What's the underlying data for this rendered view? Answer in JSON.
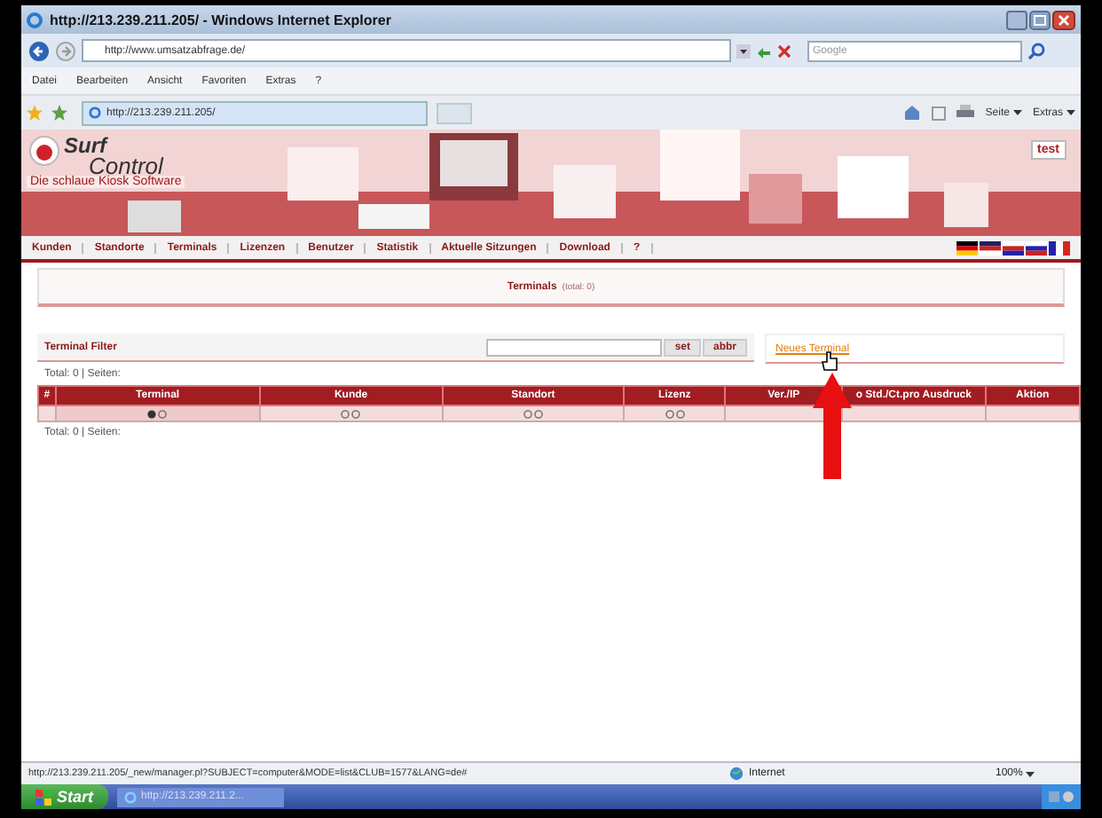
{
  "window": {
    "title": "http://213.239.211.205/ - Windows Internet Explorer"
  },
  "address_bar": {
    "value": "http://www.umsatzabfrage.de/"
  },
  "search": {
    "placeholder": "Google"
  },
  "menu": [
    "Datei",
    "Bearbeiten",
    "Ansicht",
    "Favoriten",
    "Extras",
    "?"
  ],
  "browser_tab": {
    "label": "http://213.239.211.205/"
  },
  "toolbar": [
    "Seite",
    "Extras"
  ],
  "banner": {
    "logo_top": "Surf",
    "logo_bottom": "Control",
    "slogan": "Die schlaue Kiosk Software",
    "user_button": "test"
  },
  "nav": [
    "Kunden",
    "Standorte",
    "Terminals",
    "Lizenzen",
    "Benutzer",
    "Statistik",
    "Aktuelle Sitzungen",
    "Download",
    "?"
  ],
  "heading": {
    "title": "Terminals",
    "count": "(total: 0)"
  },
  "filter": {
    "label": "Terminal Filter",
    "buttons": [
      "set",
      "abbr"
    ],
    "link": "Neues Terminal"
  },
  "totals_top": "Total: 0 | Seiten:",
  "table": {
    "columns": [
      {
        "label": "#",
        "sortable": false,
        "sorted": false
      },
      {
        "label": "Terminal",
        "sortable": true,
        "sorted": true
      },
      {
        "label": "Kunde",
        "sortable": true,
        "sorted": false
      },
      {
        "label": "Standort",
        "sortable": true,
        "sorted": false
      },
      {
        "label": "Lizenz",
        "sortable": true,
        "sorted": false
      },
      {
        "label": "Ver./IP",
        "sortable": false,
        "sorted": false
      },
      {
        "label": "o Std./Ct.pro Ausdruck",
        "sortable": false,
        "sorted": false
      },
      {
        "label": "Aktion",
        "sortable": false,
        "sorted": false
      }
    ]
  },
  "totals_bottom": "Total: 0 | Seiten:",
  "status_bar": {
    "url": "http://213.239.211.205/_new/manager.pl?SUBJECT=computer&MODE=list&CLUB=1577&LANG=de#",
    "zone": "Internet",
    "zoom": "100%"
  },
  "taskbar": {
    "start": "Start",
    "task": "http://213.239.211.2..."
  }
}
